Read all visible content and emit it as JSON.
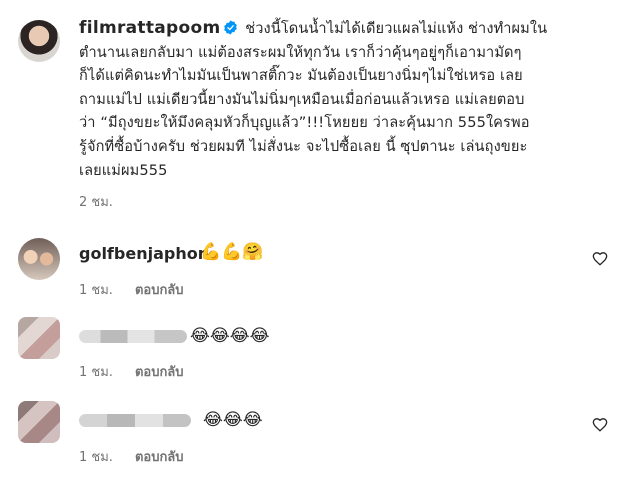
{
  "post": {
    "username": "filmrattapoom",
    "caption_lines": [
      "ช่วงนี้โดนน้ำไม่ได้เดียวแผลไม่แห้ง ช่างทำผมใน",
      "ตำนานเลยกลับมา แม่ต้องสระผมให้ทุกวัน เราก็ว่าคุ้นๆอยู่ๆก็เอามามัดๆ",
      "ก็ได้แต่คิดนะทำไมมันเป็นพาสติ๊กวะ มันต้องเป็นยางนิ่มๆไม่ใช่เหรอ เลย",
      "ถามแม่ไป แม่เดียวนี้ยางมันไม่นิ่มๆเหมือนเมื่อก่อนแล้วเหรอ แม่เลยตอบ",
      "ว่า “มีถุงขยะให้มึงคลุมหัวก็บุญแล้ว”!!!โหยยย ว่าละคุ้นมาก 555ใครพอ",
      "รู้จักที่ซื้อบ้างครับ ช่วยผมที ไม่สั่งนะ จะไปซื้อเลย นี้ ซุปตานะ เล่นถุงขยะ",
      "เลยแม่ผม555"
    ],
    "time": "2 ชม."
  },
  "comments": [
    {
      "username": "golfbenjaphon",
      "text": "💪💪🤗",
      "time": "1 ชม.",
      "reply_label": "ตอบกลับ"
    },
    {
      "username": "",
      "text": "😂😂😂😂",
      "time": "1 ชม.",
      "reply_label": "ตอบกลับ"
    },
    {
      "username": "",
      "text": "😂😂😂",
      "time": "1 ชม.",
      "reply_label": "ตอบกลับ"
    }
  ],
  "icons": {
    "verified": "verified-badge-icon",
    "like": "heart-icon"
  },
  "colors": {
    "verified": "#0095f6",
    "text": "#262626",
    "secondary": "#737373"
  }
}
